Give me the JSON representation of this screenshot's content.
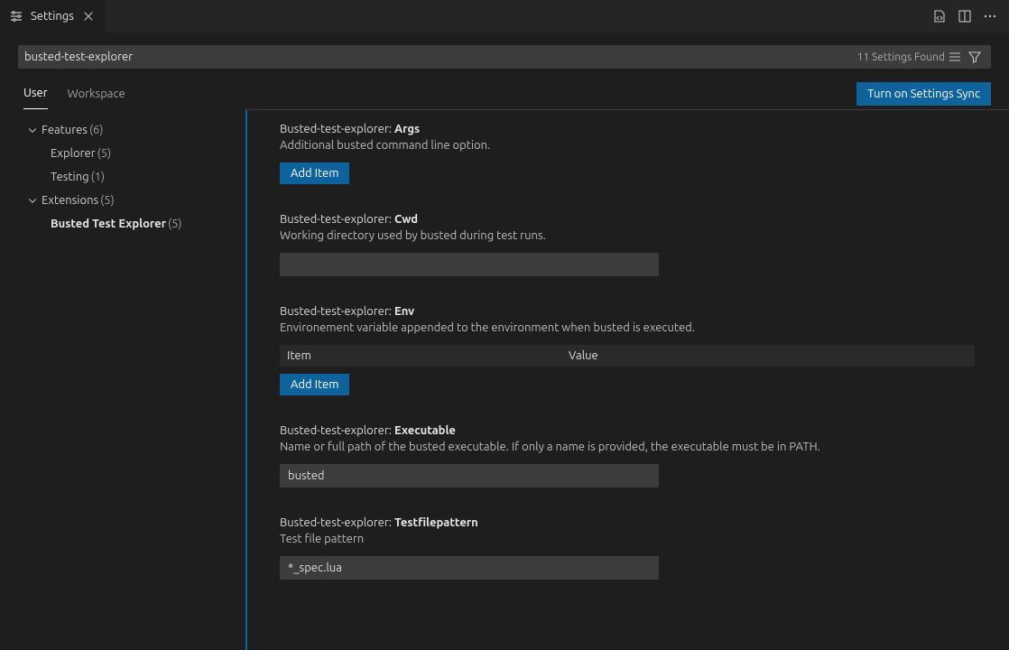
{
  "tab": {
    "title": "Settings"
  },
  "search": {
    "value": "busted-test-explorer",
    "results_label": "11 Settings Found"
  },
  "scopes": {
    "user": "User",
    "workspace": "Workspace"
  },
  "sync_button": "Turn on Settings Sync",
  "tree": {
    "features": {
      "label": "Features",
      "count": "(6)"
    },
    "explorer": {
      "label": "Explorer",
      "count": "(5)"
    },
    "testing": {
      "label": "Testing",
      "count": "(1)"
    },
    "extensions": {
      "label": "Extensions",
      "count": "(5)"
    },
    "busted": {
      "label": "Busted Test Explorer",
      "count": "(5)"
    }
  },
  "settings": {
    "args": {
      "prefix": "Busted-test-explorer: ",
      "name": "Args",
      "desc": "Additional busted command line option.",
      "add": "Add Item"
    },
    "cwd": {
      "prefix": "Busted-test-explorer: ",
      "name": "Cwd",
      "desc": "Working directory used by busted during test runs.",
      "value": ""
    },
    "env": {
      "prefix": "Busted-test-explorer: ",
      "name": "Env",
      "desc": "Environement variable appended to the environment when busted is executed.",
      "hdr_item": "Item",
      "hdr_value": "Value",
      "add": "Add Item"
    },
    "exe": {
      "prefix": "Busted-test-explorer: ",
      "name": "Executable",
      "desc": "Name or full path of the busted executable. If only a name is provided, the executable must be in PATH.",
      "value": "busted"
    },
    "testpat": {
      "prefix": "Busted-test-explorer: ",
      "name": "Testfilepattern",
      "desc": "Test file pattern",
      "value": "*_spec.lua"
    }
  }
}
